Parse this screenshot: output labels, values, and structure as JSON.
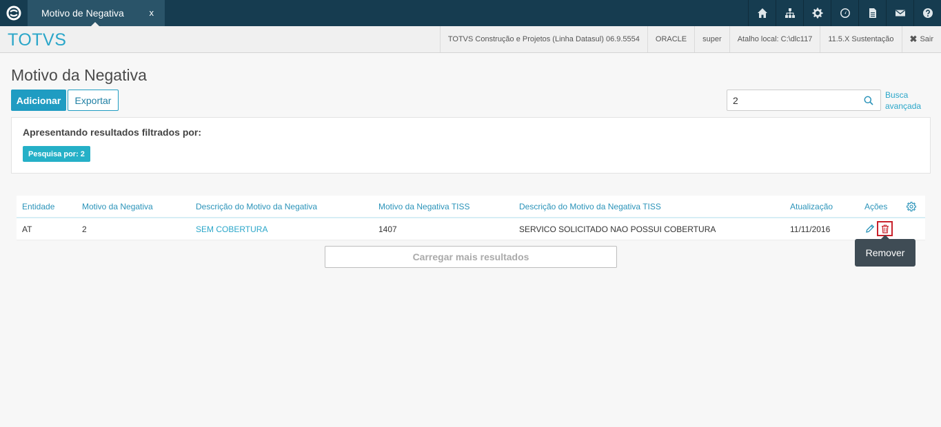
{
  "topbar": {
    "tab_title": "Motivo de Negativa",
    "tab_close": "x",
    "icons": [
      "home-icon",
      "sitemap-icon",
      "gear-icon",
      "gauge-icon",
      "document-icon",
      "mail-icon",
      "help-icon"
    ]
  },
  "infobar": {
    "brand": "TOTVS",
    "product": "TOTVS Construção e Projetos (Linha Datasul) 06.9.5554",
    "database": "ORACLE",
    "user": "super",
    "shortcut": "Atalho local: C:\\dlc117",
    "version": "11.5.X Sustentação",
    "logout_label": "Sair"
  },
  "page": {
    "title": "Motivo da Negativa",
    "add_label": "Adicionar",
    "export_label": "Exportar",
    "search_value": "2",
    "advanced_search_label": "Busca avançada"
  },
  "filter": {
    "title": "Apresentando resultados filtrados por:",
    "tag": "Pesquisa por: 2"
  },
  "table": {
    "headers": {
      "entidade": "Entidade",
      "motivo": "Motivo da Negativa",
      "descricao": "Descrição do Motivo da Negativa",
      "motivo_tiss": "Motivo da Negativa TISS",
      "descricao_tiss": "Descrição do Motivo da Negativa TISS",
      "atualizacao": "Atualização",
      "acoes": "Ações"
    },
    "rows": [
      {
        "entidade": "AT",
        "motivo": "2",
        "descricao": "SEM COBERTURA",
        "motivo_tiss": "1407",
        "descricao_tiss": "SERVICO SOLICITADO NAO POSSUI COBERTURA",
        "atualizacao": "11/11/2016"
      }
    ],
    "load_more_label": "Carregar mais resultados"
  },
  "tooltip": {
    "text": "Remover"
  },
  "colors": {
    "navy": "#163c50",
    "accent": "#1f9cc2",
    "brand": "#2aa6c9",
    "danger": "#c8202a",
    "tag": "#25b0c7"
  }
}
